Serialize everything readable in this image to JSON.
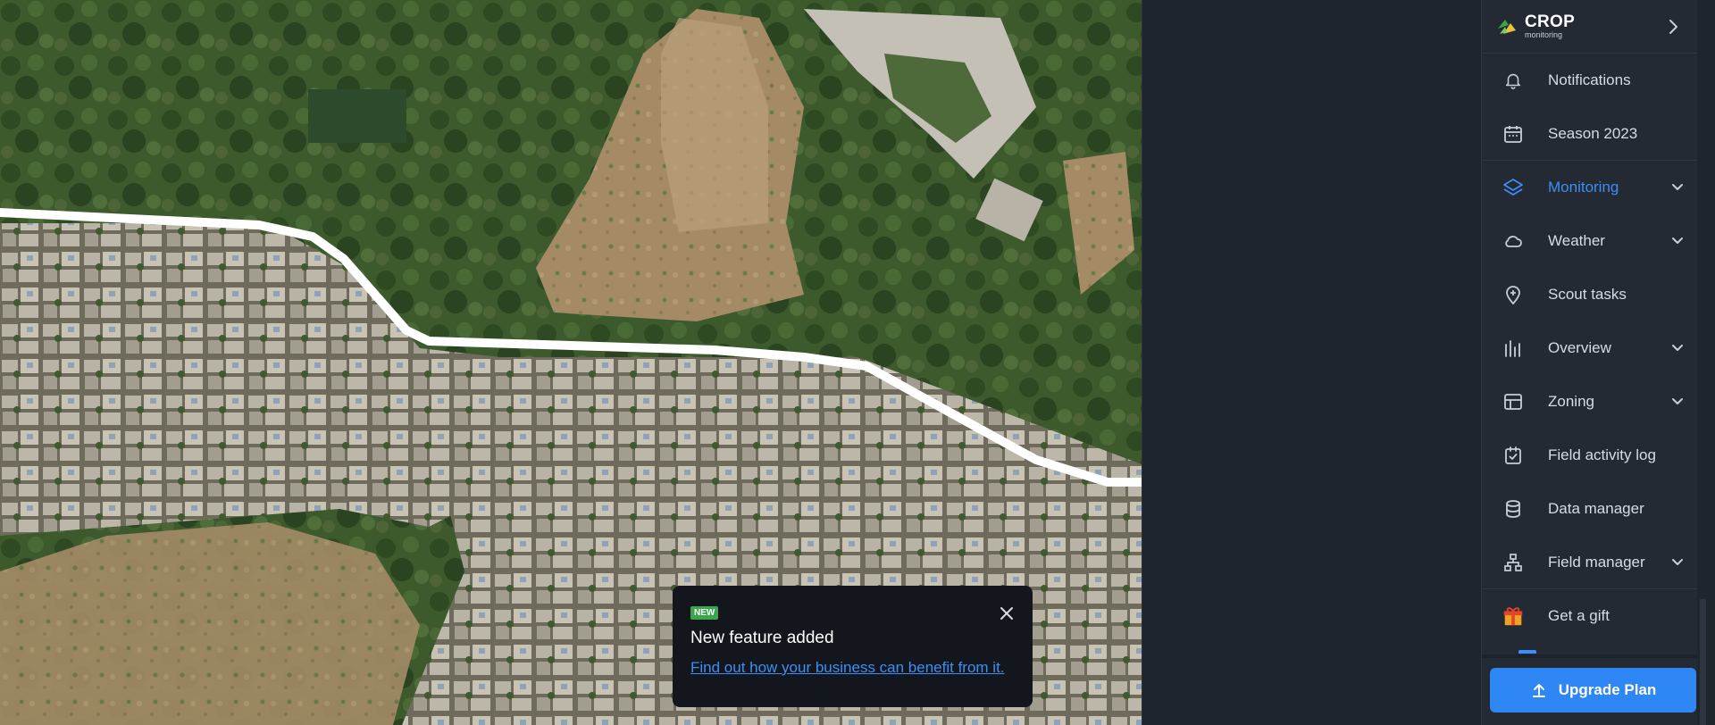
{
  "brand": {
    "name": "CROP",
    "subtitle": "monitoring"
  },
  "sidebar": {
    "items": [
      {
        "label": "Notifications",
        "icon": "bell-icon"
      },
      {
        "label": "Season 2023",
        "icon": "calendar-icon"
      },
      {
        "label": "Monitoring",
        "icon": "layers-icon",
        "active": true,
        "expandable": true
      },
      {
        "label": "Weather",
        "icon": "cloud-icon",
        "expandable": true
      },
      {
        "label": "Scout tasks",
        "icon": "map-pin-icon"
      },
      {
        "label": "Overview",
        "icon": "bar-chart-icon",
        "expandable": true
      },
      {
        "label": "Zoning",
        "icon": "layout-icon",
        "expandable": true
      },
      {
        "label": "Field activity log",
        "icon": "clipboard-check-icon"
      },
      {
        "label": "Data manager",
        "icon": "database-icon"
      },
      {
        "label": "Field manager",
        "icon": "hierarchy-icon",
        "expandable": true
      },
      {
        "label": "Get a gift",
        "icon": "gift-icon"
      }
    ],
    "upgrade_label": "Upgrade Plan"
  },
  "toast": {
    "badge": "NEW",
    "title": "New feature added",
    "link": "Find out how your business can benefit from it."
  },
  "colors": {
    "accent": "#3d8ef5",
    "sidebar_bg": "#232a33",
    "upgrade_bg": "#2f86f5",
    "badge_bg": "#3aa54a"
  }
}
